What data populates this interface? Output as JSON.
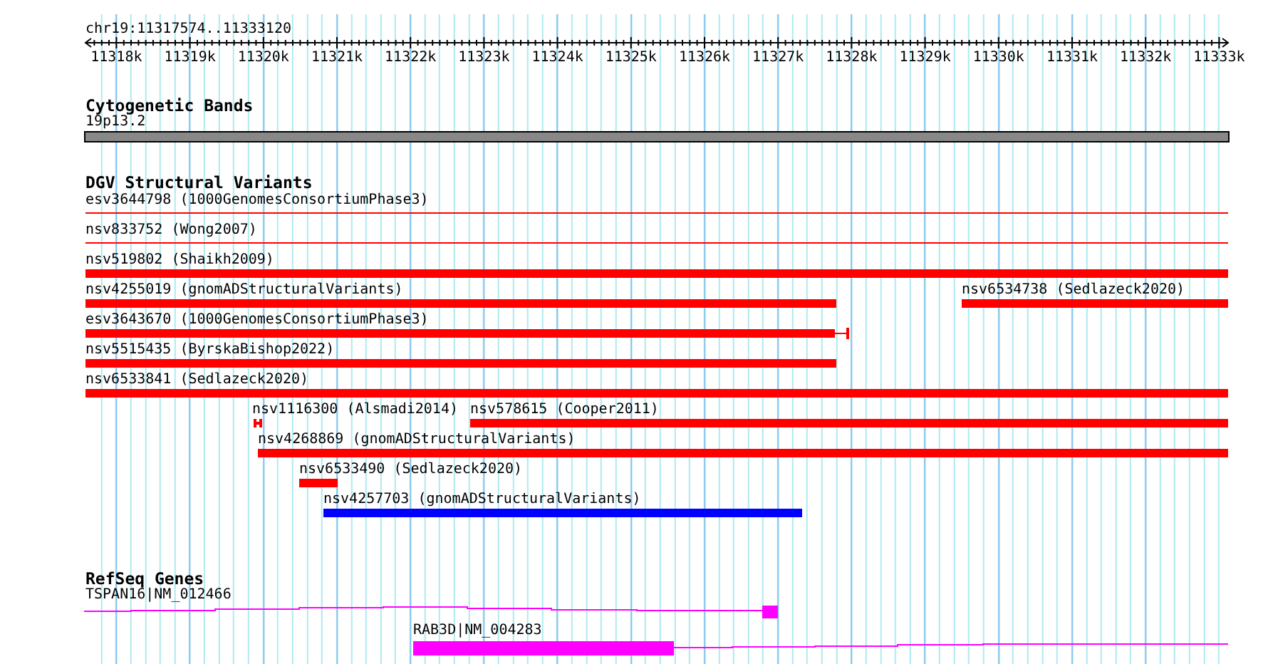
{
  "ruler": {
    "location": "chr19:11317574..11333120",
    "ticks": [
      "11318k",
      "11319k",
      "11320k",
      "11321k",
      "11322k",
      "11323k",
      "11324k",
      "11325k",
      "11326k",
      "11327k",
      "11328k",
      "11329k",
      "11330k",
      "11331k",
      "11332k",
      "11333k"
    ]
  },
  "tracks": [
    {
      "title": "Cytogenetic Bands",
      "kind": "cytoband",
      "features": [
        {
          "label": "19p13.2",
          "kind": "band"
        }
      ]
    },
    {
      "title": "DGV Structural Variants",
      "kind": "variants",
      "features": [
        {
          "label": "esv3644798 (1000GenomesConsortiumPhase3)",
          "kind": "thin",
          "color": "#ff0000"
        },
        {
          "label": "nsv833752 (Wong2007)",
          "kind": "thin",
          "color": "#ff0000"
        },
        {
          "label": "nsv519802 (Shaikh2009)",
          "kind": "bar",
          "color": "#ff0000"
        },
        {
          "label": "nsv4255019 (gnomADStructuralVariants)",
          "kind": "bar",
          "color": "#ff0000"
        },
        {
          "label": "nsv6534738 (Sedlazeck2020)",
          "kind": "bar",
          "color": "#ff0000"
        },
        {
          "label": "esv3643670 (1000GenomesConsortiumPhase3)",
          "kind": "whisker",
          "color": "#ff0000"
        },
        {
          "label": "nsv5515435 (ByrskaBishop2022)",
          "kind": "bar",
          "color": "#ff0000"
        },
        {
          "label": "nsv6533841 (Sedlazeck2020)",
          "kind": "bar",
          "color": "#ff0000"
        },
        {
          "label": "nsv1116300 (Alsmadi2014)",
          "kind": "tiny",
          "color": "#ff0000"
        },
        {
          "label": "nsv578615 (Cooper2011)",
          "kind": "bar",
          "color": "#ff0000"
        },
        {
          "label": "nsv4268869 (gnomADStructuralVariants)",
          "kind": "bar",
          "color": "#ff0000"
        },
        {
          "label": "nsv6533490 (Sedlazeck2020)",
          "kind": "bar",
          "color": "#ff0000"
        },
        {
          "label": "nsv4257703 (gnomADStructuralVariants)",
          "kind": "bar",
          "color": "#0000ff"
        }
      ]
    },
    {
      "title": "RefSeq Genes",
      "kind": "genes",
      "features": [
        {
          "label": "TSPAN16|NM_012466",
          "kind": "gene"
        },
        {
          "label": "RAB3D|NM_004283",
          "kind": "gene"
        }
      ]
    }
  ]
}
